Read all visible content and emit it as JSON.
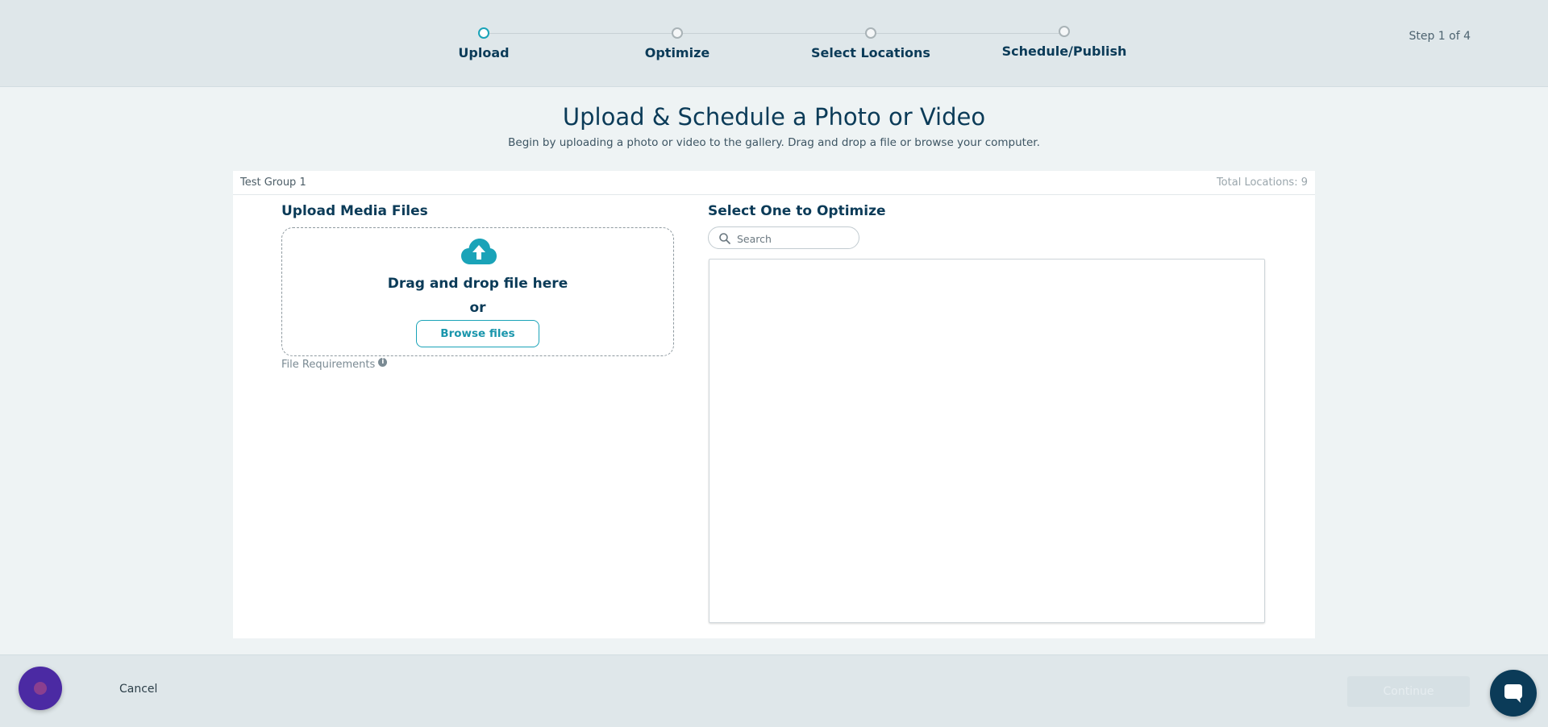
{
  "stepper": {
    "steps": [
      {
        "label": "Upload",
        "active": true
      },
      {
        "label": "Optimize",
        "active": false
      },
      {
        "label": "Select Locations",
        "active": false
      },
      {
        "label": "Schedule/Publish",
        "active": false
      }
    ],
    "counter": "Step 1 of 4"
  },
  "page": {
    "title": "Upload & Schedule a Photo or Video",
    "subtitle": "Begin by uploading a photo or video to the gallery. Drag and drop a file or browse your computer."
  },
  "panel": {
    "group_name": "Test Group 1",
    "total_locations": "Total Locations: 9"
  },
  "upload": {
    "title": "Upload Media Files",
    "drop_text": "Drag and drop file here",
    "or_text": "or",
    "browse_label": "Browse files",
    "requirements_label": "File Requirements",
    "icon": "cloud-upload-icon"
  },
  "optimize": {
    "title": "Select One to Optimize",
    "search_placeholder": "Search",
    "search_value": ""
  },
  "footer": {
    "cancel_label": "Cancel",
    "continue_label": "Continue"
  },
  "colors": {
    "accent": "#1aa3b8",
    "navy": "#0b3b58",
    "header_bg": "#dfe7ea",
    "page_bg": "#eef3f4"
  }
}
